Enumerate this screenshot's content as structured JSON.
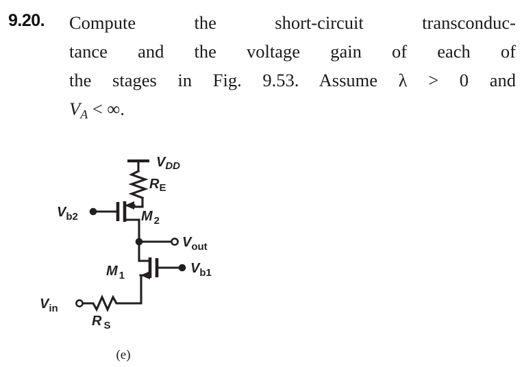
{
  "problem": {
    "number": "9.20.",
    "lines": [
      "Compute the short-circuit transconduc-",
      "tance and the voltage gain of each of",
      "the stages in Fig. 9.53. Assume λ > 0 and"
    ],
    "last_line_prefix": "V",
    "last_line_sub": "A",
    "last_line_suffix": " < ∞."
  },
  "figure": {
    "caption": "(e)",
    "labels": {
      "vdd_main": "V",
      "vdd_sub": "DD",
      "re_main": "R",
      "re_sub": "E",
      "m2_main": "M",
      "m2_sub": "2",
      "vb2_main": "V",
      "vb2_sub": "b2",
      "vout_main": "V",
      "vout_sub": "out",
      "m1_main": "M",
      "m1_sub": "1",
      "vb1_main": "V",
      "vb1_sub": "b1",
      "vin_main": "V",
      "vin_sub": "in",
      "rs_main": "R",
      "rs_sub": "S"
    },
    "components": [
      {
        "name": "supply-rail-vdd",
        "type": "supply"
      },
      {
        "name": "resistor-re",
        "type": "resistor"
      },
      {
        "name": "transistor-m2",
        "type": "nmos"
      },
      {
        "name": "node-vout",
        "type": "terminal"
      },
      {
        "name": "transistor-m1",
        "type": "nmos"
      },
      {
        "name": "resistor-rs",
        "type": "resistor"
      },
      {
        "name": "terminal-vin",
        "type": "terminal"
      },
      {
        "name": "terminal-vb1",
        "type": "terminal"
      },
      {
        "name": "terminal-vb2",
        "type": "terminal"
      }
    ]
  },
  "colors": {
    "ink": "#231f20",
    "page": "#ffffff",
    "text": "#1a1a1a"
  }
}
